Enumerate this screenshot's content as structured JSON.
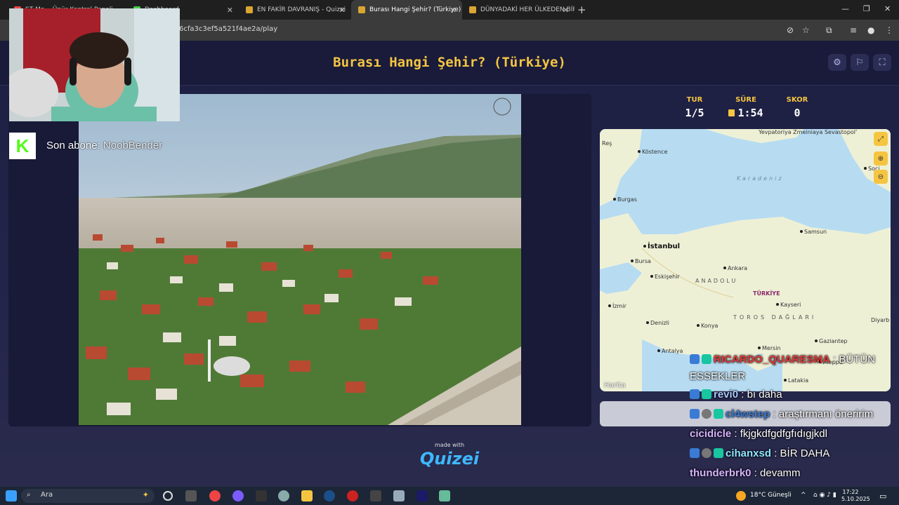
{
  "browser": {
    "tabs": [
      {
        "label": "ST Ma... Ünür Kontrol Paneli",
        "favicon_color": "#e44"
      },
      {
        "label": "Dashboard",
        "favicon_color": "#4c4"
      },
      {
        "label": "EN FAKİR DAVRANIŞ - Quizei",
        "favicon_color": "#d9a632"
      },
      {
        "label": "Burası Hangi Şehir? (Türkiye) - Q",
        "favicon_color": "#d9a632",
        "active": true
      },
      {
        "label": "DÜNYADAKİ HER ÜLKEDEN BİR",
        "favicon_color": "#d9a632"
      }
    ],
    "url": "6cfa3c3ef5a521f4ae2a/play"
  },
  "game": {
    "title": "Burası Hangi Şehir? (Türkiye)",
    "header_icons": [
      "gear-icon",
      "flag-icon",
      "fullscreen-icon"
    ],
    "stats": {
      "round_label": "TUR",
      "round_value": "1/5",
      "time_label": "SÜRE",
      "time_value": "1:54",
      "score_label": "SKOR",
      "score_value": "0"
    },
    "made_with": "made with",
    "logo": "Quizei"
  },
  "map": {
    "sea_label": "Karadeniz",
    "region_label": "ANADOLU",
    "country_label": "TÜRKİYE",
    "mountain_label": "TOROS DAĞLARI",
    "places": [
      "Yevpatoriya Zmeiniaya Sevastopol'",
      "Köstence",
      "Burgas",
      "İstanbul",
      "Bursa",
      "Samsun",
      "Eskişehir",
      "Ankara",
      "İzmir",
      "Kayseri",
      "Denizli",
      "Konya",
      "Antalya",
      "Mersin",
      "Gaziantep",
      "Aleppo",
      "Latakia",
      "Diyarb",
      "Soçi",
      "Reş"
    ],
    "attribution": "Harita",
    "colors": {
      "land": "#eef0d6",
      "water": "#b7dcf2"
    }
  },
  "stream": {
    "sub_label": "Son abone:",
    "sub_name": "NoobBender",
    "chat": [
      {
        "user": "RICARDO_QUARESMA",
        "msg": "BÜTÜN ESSEKLER",
        "color": "#e23a3a",
        "badges": [
          "b1",
          "b2"
        ]
      },
      {
        "user": "revi0",
        "msg": "bı daha",
        "color": "#a9c8ff",
        "badges": [
          "b1",
          "b2"
        ]
      },
      {
        "user": "cl4wstep",
        "msg": "araştırmanı öneririm",
        "color": "#3a7bd5",
        "badges": [
          "b1",
          "b3",
          "b2"
        ]
      },
      {
        "user": "cicidicle",
        "msg": "fkjgkdfgdfgfıdıgjkdl",
        "color": "#d7b3ff",
        "badges": []
      },
      {
        "user": "cihanxsd",
        "msg": "BİR DAHA",
        "color": "#8ee6ff",
        "badges": [
          "b1",
          "b3",
          "b2"
        ]
      },
      {
        "user": "thunderbrk0",
        "msg": "devamm",
        "color": "#d7b3ff",
        "badges": []
      }
    ]
  },
  "taskbar": {
    "search_placeholder": "Ara",
    "weather": "18°C  Güneşli",
    "time": "17:22",
    "date": "5.10.2025"
  }
}
